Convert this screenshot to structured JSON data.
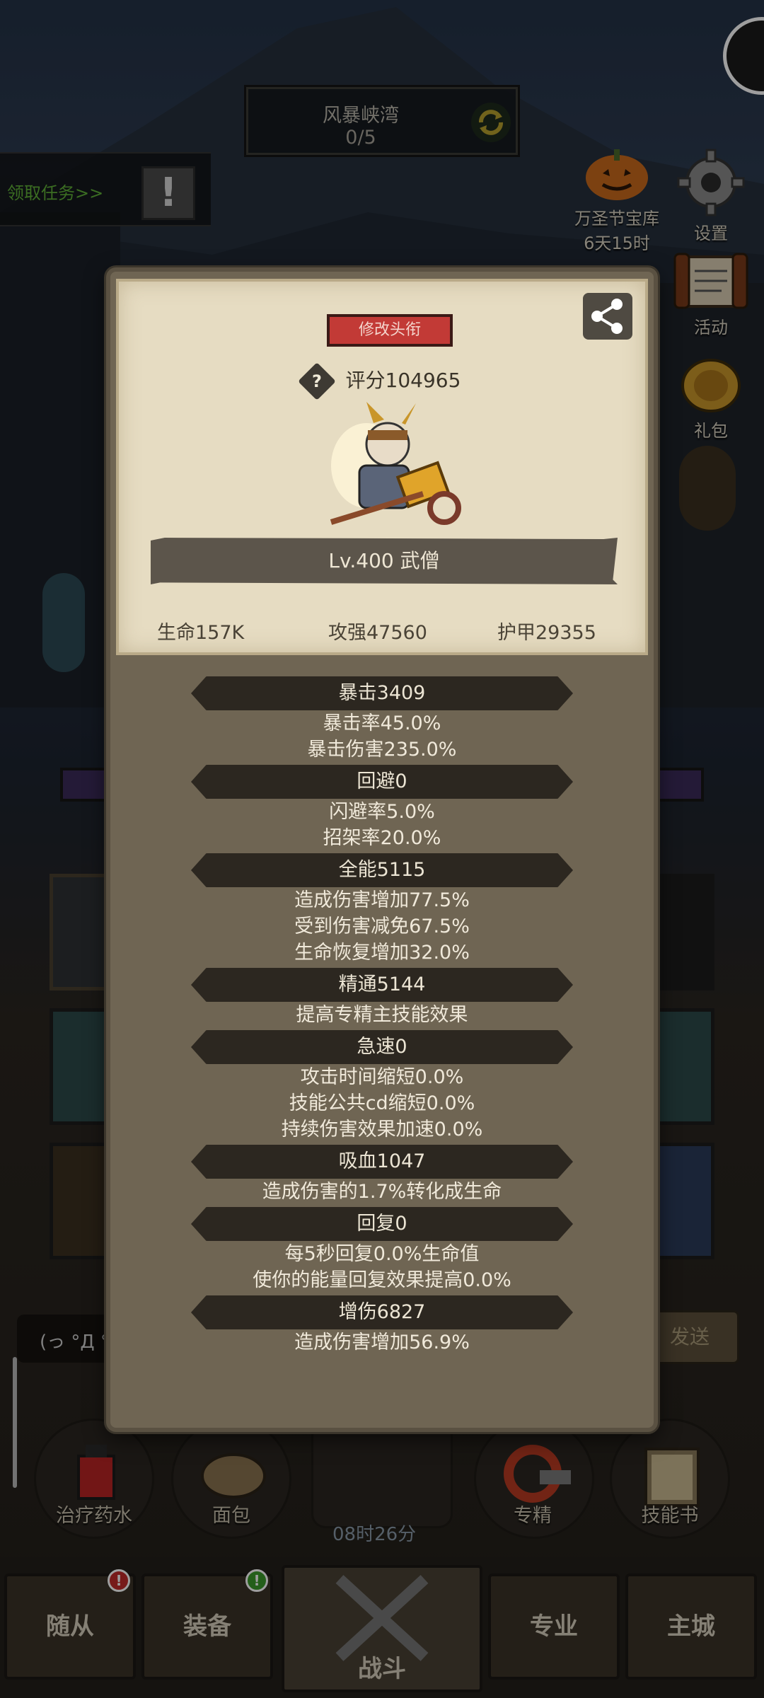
{
  "region": {
    "title": "风暴峡湾",
    "progress": "0/5"
  },
  "task": {
    "label": "领取任务>>",
    "alert": "!"
  },
  "side_icons": [
    {
      "label": "万圣节宝库",
      "sub": "6天15时"
    },
    {
      "label": "设置"
    },
    {
      "label": "活动"
    },
    {
      "label": "礼包"
    }
  ],
  "chat": {
    "emoticon": "(っ °Д °",
    "send": "发送"
  },
  "items": [
    {
      "label": "治疗药水"
    },
    {
      "label": "面包"
    },
    {
      "label": "专精"
    },
    {
      "label": "技能书"
    }
  ],
  "timer": "08时26分",
  "nav": [
    {
      "label": "随从",
      "badge": "!"
    },
    {
      "label": "装备",
      "badge": "!"
    },
    {
      "label": "战斗"
    },
    {
      "label": "专业"
    },
    {
      "label": "主城"
    }
  ],
  "profile": {
    "title_button": "修改头衔",
    "help": "?",
    "score": "评分104965",
    "level": "Lv.400 武僧",
    "hp": "生命157K",
    "atk": "攻强47560",
    "armor": "护甲29355"
  },
  "stats": [
    {
      "head": "暴击3409",
      "lines": [
        "暴击率45.0%",
        "暴击伤害235.0%"
      ]
    },
    {
      "head": "回避0",
      "lines": [
        "闪避率5.0%",
        "招架率20.0%"
      ]
    },
    {
      "head": "全能5115",
      "lines": [
        "造成伤害增加77.5%",
        "受到伤害减免67.5%",
        "生命恢复增加32.0%"
      ]
    },
    {
      "head": "精通5144",
      "lines": [
        "提高专精主技能效果"
      ]
    },
    {
      "head": "急速0",
      "lines": [
        "攻击时间缩短0.0%",
        "技能公共cd缩短0.0%",
        "持续伤害效果加速0.0%"
      ]
    },
    {
      "head": "吸血1047",
      "lines": [
        "造成伤害的1.7%转化成生命"
      ]
    },
    {
      "head": "回复0",
      "lines": [
        "每5秒回复0.0%生命值",
        "使你的能量回复效果提高0.0%"
      ]
    },
    {
      "head": "增伤6827",
      "lines": [
        "造成伤害增加56.9%"
      ]
    }
  ]
}
